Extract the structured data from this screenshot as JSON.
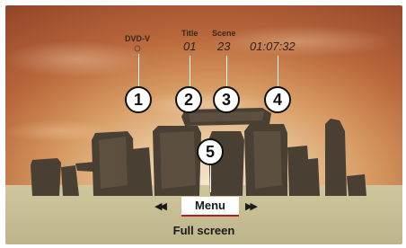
{
  "overlay": {
    "source": "DVD-V",
    "title_label": "Title",
    "title_value": "01",
    "scene_label": "Scene",
    "scene_value": "23",
    "time_value": "01:07:32"
  },
  "callouts": [
    "1",
    "2",
    "3",
    "4",
    "5"
  ],
  "controls": {
    "prev_icon": "skip-back-icon",
    "prev_glyph": "◀◀",
    "menu_label": "Menu",
    "next_icon": "skip-forward-icon",
    "next_glyph": "▶▶"
  },
  "footer": {
    "label": "Full screen"
  },
  "colors": {
    "sky_top": "#8a3e25",
    "sky_glow": "#f4e7cf",
    "ground": "#cfc69e",
    "menu_underline": "#b32020"
  }
}
